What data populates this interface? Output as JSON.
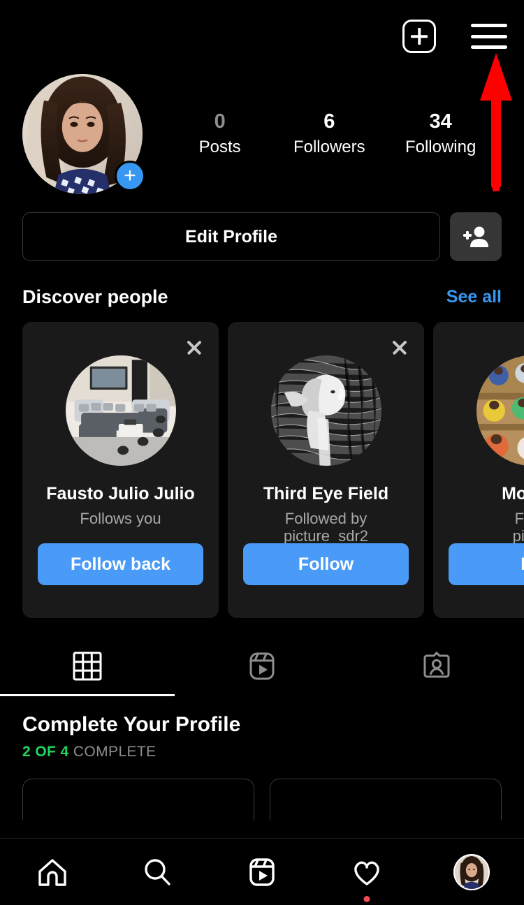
{
  "topbar": {
    "new_post_icon": "plus-square-icon",
    "menu_icon": "hamburger-menu-icon"
  },
  "annotation": {
    "arrow_icon": "red-up-arrow",
    "color": "#FF0000",
    "points_at": "hamburger-menu-icon"
  },
  "profile": {
    "avatar_icon": "user-profile-photo",
    "add_story_badge": "+",
    "stats": [
      {
        "value": "0",
        "label": "Posts"
      },
      {
        "value": "6",
        "label": "Followers"
      },
      {
        "value": "34",
        "label": "Following"
      }
    ]
  },
  "actions": {
    "edit_profile_label": "Edit Profile",
    "add_person_icon": "person-add-icon"
  },
  "discover": {
    "title": "Discover people",
    "see_all_label": "See all",
    "cards": [
      {
        "name": "Fausto Julio Julio",
        "subtitle": "Follows you",
        "button_label": "Follow back",
        "avatar_icon": "living-room-photo",
        "close_icon": "close-icon"
      },
      {
        "name": "Third Eye Field",
        "subtitle": "Followed by\npicture_sdr2",
        "button_label": "Follow",
        "avatar_icon": "engraving-portrait-photo",
        "close_icon": "close-icon"
      },
      {
        "name": "Moises",
        "subtitle": "Follo\npictur",
        "button_label": "Fo",
        "avatar_icon": "spray-cans-photo",
        "close_icon": "close-icon"
      }
    ]
  },
  "profile_tabs": [
    {
      "icon": "grid-icon",
      "name": "posts-grid-tab",
      "active": true
    },
    {
      "icon": "reels-icon",
      "name": "reels-tab",
      "active": false
    },
    {
      "icon": "tagged-icon",
      "name": "tagged-tab",
      "active": false
    }
  ],
  "complete_profile": {
    "title": "Complete Your Profile",
    "progress_done": "2 OF 4",
    "progress_rest": "COMPLETE"
  },
  "bottom_nav": [
    {
      "icon": "home-icon",
      "name": "nav-home",
      "badge": false
    },
    {
      "icon": "search-icon",
      "name": "nav-search",
      "badge": false
    },
    {
      "icon": "reels-icon",
      "name": "nav-reels",
      "badge": false
    },
    {
      "icon": "heart-icon",
      "name": "nav-activity",
      "badge": true
    },
    {
      "icon": "avatar-icon",
      "name": "nav-profile",
      "badge": false
    }
  ],
  "colors": {
    "background": "#000000",
    "accent_blue": "#3897F0",
    "follow_blue": "#4A9BF7",
    "card_bg": "#1A1A1A",
    "muted_text": "#A8A8A8",
    "progress_green": "#1ED760",
    "notification_red": "#ED4956",
    "annotation_red": "#FF0000"
  }
}
